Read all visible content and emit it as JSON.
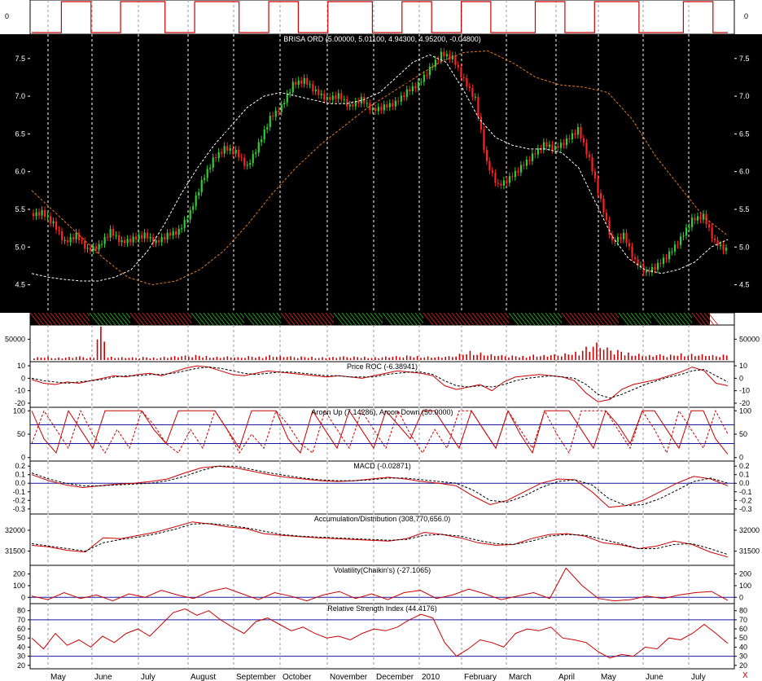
{
  "chart_data": {
    "type": "multi-panel-stock-chart",
    "month_labels": [
      "May",
      "June",
      "July",
      "August",
      "September",
      "October",
      "November",
      "December",
      "2010",
      "February",
      "March",
      "April",
      "May",
      "June",
      "July"
    ],
    "close_marker": "X",
    "panels": [
      {
        "id": "signal",
        "type": "line",
        "title": "",
        "ticks": [
          "0"
        ],
        "ylim": [
          -1,
          1
        ],
        "series": [
          {
            "color": "#cc0000",
            "values": [
              -1,
              -1,
              1,
              1,
              -1,
              -1,
              1,
              1,
              1,
              -1,
              -1,
              1,
              1,
              1,
              -1,
              -1,
              1,
              1,
              -1,
              -1,
              1,
              1,
              1,
              -1,
              -1,
              1,
              1,
              -1,
              -1,
              1,
              1,
              -1,
              -1,
              -1,
              1,
              1,
              -1,
              -1,
              1,
              1,
              1,
              -1,
              -1,
              -1,
              1,
              1,
              -1,
              -1
            ]
          }
        ]
      },
      {
        "id": "price",
        "type": "candlestick",
        "title": "BRISA ORD (5.00000, 5.01100, 4.94300, 4.95200, -0.04800)",
        "ticks": [
          "7.5",
          "7.0",
          "6.5",
          "6.0",
          "5.5",
          "5.0",
          "4.5"
        ],
        "tick_values": [
          7.5,
          7.0,
          6.5,
          6.0,
          5.5,
          5.0,
          4.5
        ],
        "ylim": [
          4.15,
          7.8
        ],
        "close": [
          5.45,
          5.3,
          5.05,
          5.15,
          4.95,
          5.0,
          5.2,
          5.05,
          5.1,
          5.15,
          5.05,
          5.15,
          5.2,
          5.45,
          5.85,
          6.15,
          6.3,
          6.25,
          6.05,
          6.35,
          6.7,
          6.85,
          7.15,
          7.2,
          7.05,
          6.95,
          7.0,
          6.85,
          6.95,
          6.8,
          6.85,
          6.9,
          7.05,
          7.15,
          7.35,
          7.55,
          7.5,
          7.2,
          6.95,
          6.1,
          5.8,
          5.9,
          6.05,
          6.2,
          6.35,
          6.3,
          6.4,
          6.55,
          6.15,
          5.6,
          5.05,
          5.15,
          4.8,
          4.65,
          4.75,
          4.9,
          5.1,
          5.35,
          5.4,
          5.05,
          4.95
        ],
        "markers": [
          "T",
          "T",
          "T",
          "U",
          "T",
          "U",
          "T",
          "T",
          "U",
          "T",
          "U",
          "T",
          "T"
        ],
        "overlays": [
          {
            "name": "",
            "style": "dashed",
            "color": "#ffffff",
            "values": [
              4.65,
              4.6,
              4.57,
              4.55,
              4.55,
              4.6,
              4.7,
              4.95,
              5.3,
              5.7,
              6.05,
              6.35,
              6.6,
              6.85,
              7.0,
              7.05,
              7.0,
              6.95,
              6.9,
              6.9,
              6.95,
              7.05,
              7.25,
              7.45,
              7.55,
              7.45,
              7.1,
              6.7,
              6.45,
              6.35,
              6.3,
              6.3,
              6.25,
              6.05,
              5.6,
              5.15,
              4.85,
              4.7,
              4.65,
              4.7,
              4.8,
              5.0,
              5.1
            ]
          },
          {
            "name": "",
            "style": "dashed",
            "color": "#e07a20",
            "values": [
              5.75,
              5.45,
              5.15,
              4.85,
              4.6,
              4.5,
              4.55,
              4.7,
              4.95,
              5.3,
              5.7,
              6.05,
              6.35,
              6.6,
              6.85,
              7.05,
              7.25,
              7.45,
              7.58,
              7.6,
              7.45,
              7.25,
              7.15,
              7.12,
              7.05,
              6.7,
              6.2,
              5.8,
              5.4,
              5.15
            ]
          }
        ]
      },
      {
        "id": "volume",
        "type": "bar",
        "title": "",
        "ticks": [
          "50000"
        ],
        "tick_values": [
          50000
        ],
        "ylim": [
          0,
          80000
        ],
        "values": [
          7000,
          8500,
          6000,
          7500,
          9000,
          6500,
          80000,
          8000,
          7000,
          6500,
          7500,
          6000,
          8000,
          9500,
          11000,
          12000,
          10000,
          8000,
          9000,
          7000,
          9500,
          8500,
          12000,
          10000,
          9000,
          8500,
          8000,
          7000,
          7500,
          9000,
          8500,
          8000,
          7000,
          8500,
          9500,
          11000,
          10000,
          9000,
          8000,
          9500,
          15000,
          22000,
          18000,
          14000,
          12000,
          11000,
          10000,
          13000,
          12000,
          14000,
          16000,
          20000,
          32000,
          42000,
          30000,
          24000,
          18000,
          15000,
          12000,
          14000,
          13000,
          16000,
          15000,
          14000,
          12000,
          13000
        ]
      },
      {
        "id": "roc",
        "type": "line",
        "title": "Price ROC (-6.38941)",
        "ticks": [
          "10",
          "0",
          "-10",
          "-20"
        ],
        "tick_values": [
          10,
          0,
          -10,
          -20
        ],
        "ylim": [
          -22,
          12
        ],
        "series": [
          {
            "name": "",
            "style": "solid",
            "color": "#cc0000",
            "values": [
              -1,
              -4,
              -5,
              -3,
              -4,
              -2,
              0,
              2,
              1,
              3,
              4,
              2,
              5,
              8,
              10,
              9,
              6,
              3,
              2,
              4,
              6,
              5,
              4,
              3,
              2,
              1,
              2,
              1,
              0,
              2,
              4,
              6,
              5,
              4,
              2,
              -6,
              -9,
              -7,
              -5,
              -10,
              -3,
              1,
              2,
              3,
              2,
              1,
              -2,
              -12,
              -19,
              -17,
              -9,
              -5,
              -3,
              -1,
              2,
              5,
              9,
              6,
              -4,
              -6
            ]
          },
          {
            "name": "",
            "style": "dashed",
            "color": "#000000",
            "values": [
              0,
              -2,
              -3,
              -4,
              -3,
              -2,
              -1,
              1,
              2,
              2,
              3,
              3,
              4,
              6,
              8,
              9,
              8,
              6,
              4,
              3,
              4,
              5,
              5,
              4,
              3,
              2,
              2,
              1,
              1,
              1,
              3,
              4,
              5,
              5,
              3,
              -2,
              -6,
              -7,
              -6,
              -7,
              -5,
              -2,
              0,
              1,
              2,
              1,
              0,
              -5,
              -13,
              -16,
              -13,
              -9,
              -5,
              -2,
              1,
              3,
              6,
              7,
              2,
              -3
            ]
          }
        ]
      },
      {
        "id": "aroon",
        "type": "line",
        "title": "Aroon Up (7.14286), Aroon Down (50.0000)",
        "ticks": [
          "100",
          "50",
          "0"
        ],
        "tick_values": [
          100,
          50,
          0
        ],
        "ylim": [
          -4,
          104
        ],
        "ref_lines": [
          70,
          30
        ],
        "series": [
          {
            "name": "Aroon Up (7.14286)",
            "style": "solid",
            "color": "#cc0000",
            "values": [
              100,
              40,
              10,
              100,
              60,
              20,
              100,
              100,
              100,
              100,
              60,
              30,
              100,
              100,
              100,
              100,
              60,
              20,
              100,
              100,
              100,
              40,
              10,
              100,
              60,
              20,
              100,
              60,
              20,
              100,
              70,
              40,
              100,
              100,
              60,
              20,
              100,
              60,
              20,
              100,
              50,
              10,
              100,
              100,
              100,
              60,
              20,
              100,
              70,
              30,
              100,
              100,
              60,
              20,
              100,
              100,
              40,
              7
            ]
          },
          {
            "name": "Aroon Down (50.0000)",
            "style": "dashed",
            "color": "#cc0000",
            "values": [
              30,
              100,
              60,
              20,
              100,
              50,
              10,
              60,
              20,
              100,
              70,
              30,
              10,
              60,
              20,
              100,
              60,
              10,
              50,
              20,
              100,
              70,
              30,
              10,
              100,
              60,
              20,
              100,
              60,
              20,
              100,
              50,
              10,
              60,
              20,
              100,
              100,
              60,
              20,
              100,
              60,
              20,
              100,
              50,
              10,
              100,
              100,
              100,
              60,
              20,
              100,
              60,
              10,
              100,
              60,
              20,
              100,
              50
            ]
          }
        ]
      },
      {
        "id": "macd",
        "type": "line",
        "title": "MACD (-0.02871)",
        "ticks": [
          "0.2",
          "0.1",
          "0.0",
          "-0.1",
          "-0.2",
          "-0.3"
        ],
        "tick_values": [
          0.2,
          0.1,
          0.0,
          -0.1,
          -0.2,
          -0.3
        ],
        "ylim": [
          -0.34,
          0.24
        ],
        "ref_lines": [
          0
        ],
        "series": [
          {
            "name": "",
            "style": "solid",
            "color": "#cc0000",
            "values": [
              0.1,
              0.03,
              -0.02,
              -0.05,
              -0.03,
              -0.01,
              0.0,
              0.02,
              0.05,
              0.12,
              0.18,
              0.2,
              0.18,
              0.14,
              0.1,
              0.07,
              0.05,
              0.03,
              0.02,
              0.03,
              0.05,
              0.07,
              0.05,
              0.02,
              0.0,
              -0.03,
              -0.15,
              -0.25,
              -0.2,
              -0.1,
              0.0,
              0.05,
              0.04,
              -0.1,
              -0.28,
              -0.26,
              -0.2,
              -0.1,
              0.0,
              0.08,
              0.05,
              -0.03
            ]
          },
          {
            "name": "",
            "style": "dashed",
            "color": "#000000",
            "values": [
              0.12,
              0.05,
              0.0,
              -0.03,
              -0.03,
              -0.02,
              -0.01,
              0.0,
              0.03,
              0.08,
              0.15,
              0.2,
              0.2,
              0.16,
              0.12,
              0.09,
              0.06,
              0.04,
              0.03,
              0.03,
              0.04,
              0.06,
              0.06,
              0.04,
              0.02,
              0.0,
              -0.08,
              -0.2,
              -0.22,
              -0.15,
              -0.05,
              0.02,
              0.04,
              -0.02,
              -0.18,
              -0.26,
              -0.25,
              -0.18,
              -0.08,
              0.02,
              0.06,
              0.0
            ]
          }
        ]
      },
      {
        "id": "ad",
        "type": "line",
        "title": "Accumulation/Distribution (308,770,656.0)",
        "ticks": [
          "32000",
          "31500"
        ],
        "tick_values": [
          32000,
          31500
        ],
        "ylim": [
          31200,
          32350
        ],
        "series": [
          {
            "name": "",
            "style": "solid",
            "color": "#cc0000",
            "values": [
              31640,
              31600,
              31520,
              31480,
              31820,
              31800,
              31880,
              31960,
              32080,
              32200,
              32150,
              32080,
              32040,
              31920,
              31880,
              31850,
              31820,
              31800,
              31780,
              31760,
              31740,
              31800,
              31950,
              31900,
              31820,
              31700,
              31640,
              31660,
              31800,
              31900,
              31920,
              31860,
              31700,
              31650,
              31560,
              31620,
              31740,
              31660,
              31480,
              31360
            ]
          },
          {
            "name": "",
            "style": "dashed",
            "color": "#000000",
            "values": [
              31680,
              31620,
              31560,
              31500,
              31700,
              31780,
              31840,
              31920,
              32020,
              32150,
              32160,
              32120,
              32060,
              31980,
              31900,
              31860,
              31840,
              31820,
              31800,
              31780,
              31760,
              31780,
              31880,
              31900,
              31860,
              31760,
              31680,
              31660,
              31740,
              31860,
              31900,
              31880,
              31780,
              31680,
              31560,
              31560,
              31660,
              31680,
              31560,
              31420
            ]
          }
        ]
      },
      {
        "id": "chaikin",
        "type": "line",
        "title": "Volatility(Chaikin's) (-27.1065)",
        "ticks": [
          "200",
          "100",
          "0"
        ],
        "tick_values": [
          200,
          100,
          0
        ],
        "ylim": [
          -40,
          260
        ],
        "ref_lines": [
          0
        ],
        "series": [
          {
            "name": "",
            "style": "solid",
            "color": "#cc0000",
            "values": [
              10,
              -20,
              40,
              -10,
              20,
              -30,
              30,
              0,
              60,
              20,
              -10,
              50,
              80,
              30,
              -20,
              40,
              10,
              -30,
              20,
              50,
              -10,
              30,
              -20,
              40,
              60,
              -10,
              20,
              70,
              30,
              -20,
              10,
              40,
              -10,
              250,
              100,
              -10,
              -30,
              -20,
              10,
              -10,
              20,
              40,
              50,
              -27
            ]
          }
        ]
      },
      {
        "id": "rsi",
        "type": "line",
        "title": "Relative Strength Index (44.4176)",
        "ticks": [
          "80",
          "70",
          "60",
          "50",
          "40",
          "30",
          "20"
        ],
        "tick_values": [
          80,
          70,
          60,
          50,
          40,
          30,
          20
        ],
        "ylim": [
          18,
          86
        ],
        "ref_lines": [
          70,
          30
        ],
        "series": [
          {
            "name": "",
            "style": "solid",
            "color": "#cc0000",
            "values": [
              50,
              38,
              55,
              42,
              48,
              40,
              52,
              45,
              55,
              60,
              52,
              65,
              78,
              82,
              75,
              80,
              70,
              62,
              55,
              68,
              72,
              65,
              58,
              62,
              55,
              50,
              52,
              48,
              55,
              60,
              58,
              62,
              70,
              76,
              72,
              45,
              30,
              38,
              48,
              45,
              40,
              55,
              60,
              58,
              62,
              50,
              48,
              45,
              35,
              28,
              32,
              30,
              40,
              38,
              50,
              48,
              55,
              65,
              55,
              44
            ]
          }
        ]
      }
    ]
  }
}
